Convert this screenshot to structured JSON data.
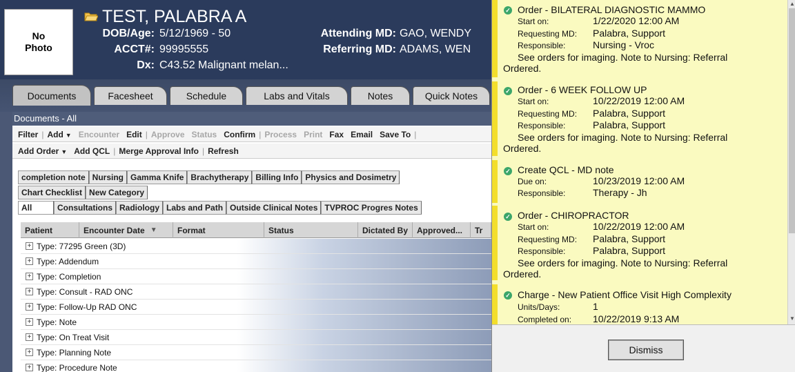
{
  "patient": {
    "photo_label": "No\nPhoto",
    "name": "TEST, PALABRA A",
    "dob_age_label": "DOB/Age:",
    "dob_age_value": "5/12/1969  -  50",
    "acct_label": "ACCT#:",
    "acct_value": "99995555",
    "dx_label": "Dx:",
    "dx_value": "C43.52 Malignant melan...",
    "attending_label": "Attending MD:",
    "attending_value": "GAO, WENDY",
    "referring_label": "Referring MD:",
    "referring_value": "ADAMS, WEN"
  },
  "tabs": [
    "Documents",
    "Facesheet",
    "Schedule",
    "Labs and Vitals",
    "Notes",
    "Quick Notes"
  ],
  "documents_title": "Documents - All",
  "toolbar1": {
    "filter": "Filter",
    "add": "Add",
    "encounter": "Encounter",
    "edit": "Edit",
    "approve": "Approve",
    "status": "Status",
    "confirm": "Confirm",
    "process": "Process",
    "print": "Print",
    "fax": "Fax",
    "email": "Email",
    "save_to": "Save To"
  },
  "toolbar2": {
    "add_order": "Add Order",
    "add_qcl": "Add QCL",
    "merge_approval": "Merge Approval Info",
    "refresh": "Refresh"
  },
  "categories_row1": [
    "completion note",
    "Nursing",
    "Gamma Knife",
    "Brachytherapy",
    "Billing Info",
    "Physics and Dosimetry"
  ],
  "categories_row2": [
    "Chart Checklist",
    "New Category"
  ],
  "categories_row3": [
    "All",
    "Consultations",
    "Radiology",
    "Labs and Path",
    "Outside Clinical Notes",
    "TVPROC Progres Notes"
  ],
  "grid_columns": [
    "Patient",
    "Encounter Date",
    "Format",
    "Status",
    "Dictated By",
    "Approved...",
    "Tr"
  ],
  "grid_rows": [
    "Type: 77295 Green (3D)",
    "Type: Addendum",
    "Type: Completion",
    "Type: Consult - RAD ONC",
    "Type: Follow-Up RAD ONC",
    "Type: Note",
    "Type: On Treat Visit",
    "Type: Planning Note",
    "Type: Procedure Note"
  ],
  "notifications": [
    {
      "title": "Order - BILATERAL DIAGNOSTIC MAMMO",
      "fields": [
        [
          "Start on:",
          "1/22/2020 12:00 AM"
        ],
        [
          "Requesting MD:",
          "Palabra, Support"
        ],
        [
          "Responsible:",
          "Nursing - Vroc"
        ]
      ],
      "note": "See orders for imaging. Note to Nursing: Referral Ordered."
    },
    {
      "title": "Order - 6 WEEK FOLLOW UP",
      "fields": [
        [
          "Start on:",
          "10/22/2019 12:00 AM"
        ],
        [
          "Requesting MD:",
          "Palabra, Support"
        ],
        [
          "Responsible:",
          "Palabra, Support"
        ]
      ],
      "note": "See orders for imaging. Note to Nursing: Referral Ordered."
    },
    {
      "title": "Create QCL - MD note",
      "fields": [
        [
          "Due on:",
          "10/23/2019 12:00 AM"
        ],
        [
          "Responsible:",
          "Therapy - Jh"
        ]
      ],
      "note": ""
    },
    {
      "title": "Order - CHIROPRACTOR",
      "fields": [
        [
          "Start on:",
          "10/22/2019 12:00 AM"
        ],
        [
          "Requesting MD:",
          "Palabra, Support"
        ],
        [
          "Responsible:",
          "Palabra, Support"
        ]
      ],
      "note": "See orders for imaging. Note to Nursing: Referral Ordered."
    },
    {
      "title": "Charge - New Patient Office Visit High Complexity",
      "fields": [
        [
          "Units/Days:",
          "1"
        ],
        [
          "Completed on:",
          "10/22/2019 9:13 AM"
        ]
      ],
      "note": ""
    }
  ],
  "dismiss_label": "Dismiss",
  "colors": {
    "header_bg": "#2b3b5c",
    "notification_bg": "#fafac0",
    "notification_bar": "#f3de2c",
    "check_green": "#3ca66a"
  }
}
